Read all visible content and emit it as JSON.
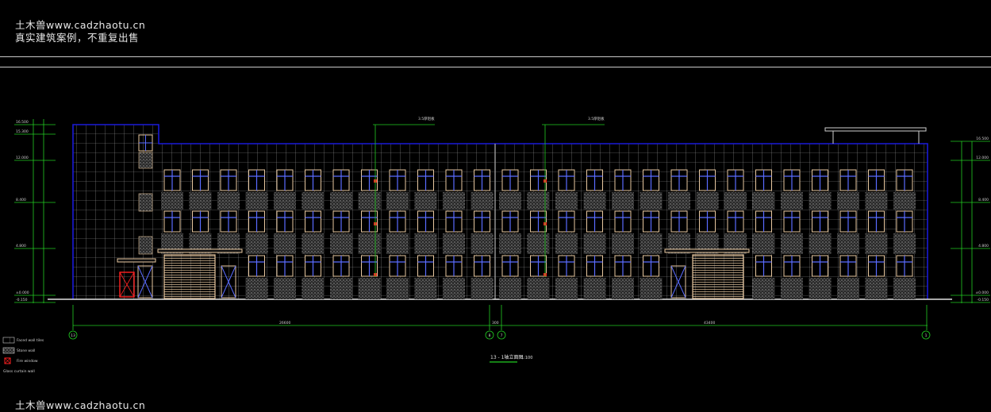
{
  "watermark": {
    "line1": "土木兽www.cadzhaotu.cn",
    "line2": "真实建筑案例，不重复出售",
    "bottom": "土木兽www.cadzhaotu.cn"
  },
  "colors": {
    "background": "#000000",
    "outline": "#1a1ad8",
    "grid": "#9a9a9a",
    "window_frame": "#e8c8a0",
    "window_glass": "#5a6cff",
    "stone": "#8a8a8a",
    "dimension": "#22cc22",
    "hatch_red": "#ff2020"
  },
  "drawing": {
    "grid_labels": [
      "13",
      "8",
      "7",
      "1"
    ],
    "dim_left": "26600",
    "dim_mid": "300",
    "dim_right": "43400",
    "title": "13 - 1轴立面图",
    "scale": "1:100",
    "callouts": [
      "3.5厚铝板",
      "3.5厚铝板"
    ],
    "left_levels": [
      "16.500",
      "15.300",
      "12.000",
      "8.400",
      "4.800",
      "±0.000",
      "-0.150"
    ],
    "right_levels": [
      "16.500",
      "12.000",
      "8.400",
      "4.800",
      "±0.000",
      "-0.150"
    ]
  },
  "legend": [
    "Faced wall tiles",
    "Stone wall",
    "Fire window",
    "Glass curtain wall"
  ]
}
